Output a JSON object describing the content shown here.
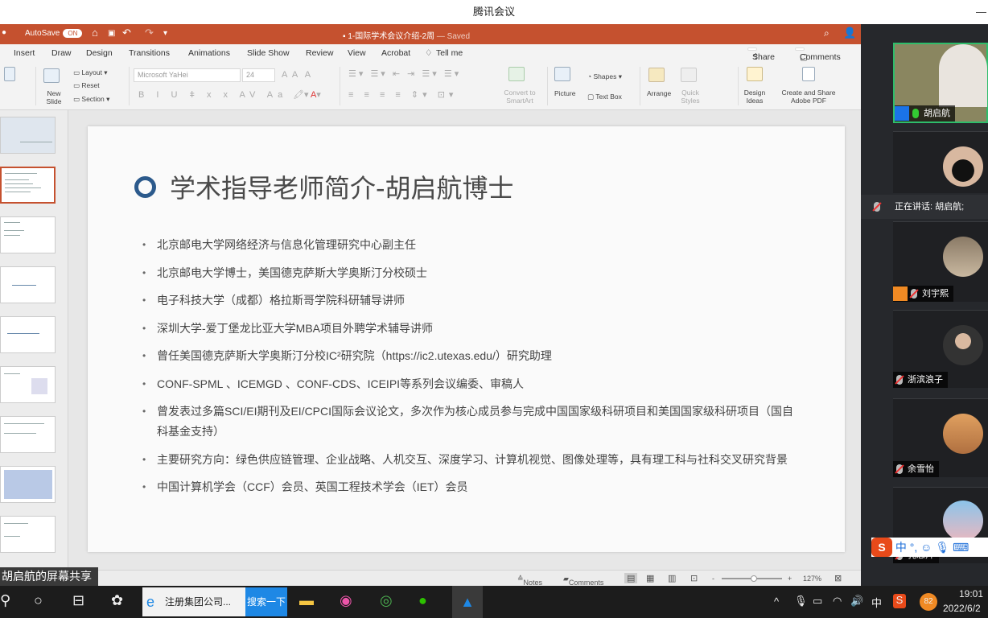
{
  "meeting": {
    "app_title": "腾讯会议",
    "share_label": "胡启航的屏幕共享",
    "speaking_label": "正在讲话: 胡启航;"
  },
  "ppt": {
    "autosave_label": "AutoSave",
    "autosave_state": "ON",
    "doc_title": "1-国际学术会议介绍-2周",
    "saved_status": "— Saved",
    "accent_color": "#c5512f",
    "tabs": [
      "Insert",
      "Draw",
      "Design",
      "Transitions",
      "Animations",
      "Slide Show",
      "Review",
      "View",
      "Acrobat",
      "Tell me"
    ],
    "share_label": "Share",
    "comments_label": "Comments",
    "ribbon": {
      "new_slide": "New Slide",
      "layout": "Layout",
      "reset": "Reset",
      "section": "Section",
      "font_name": "Microsoft YaHei",
      "font_size": "24",
      "convert_smartart": "Convert to SmartArt",
      "picture": "Picture",
      "shapes": "Shapes",
      "text_box": "Text Box",
      "arrange": "Arrange",
      "quick_styles": "Quick Styles",
      "design_ideas": "Design Ideas",
      "create_share_pdf": "Create and Share Adobe PDF"
    },
    "slide": {
      "title": "学术指导老师简介-胡启航博士",
      "bullets": [
        "北京邮电大学网络经济与信息化管理研究中心副主任",
        "北京邮电大学博士，美国德克萨斯大学奥斯汀分校硕士",
        "电子科技大学（成都）格拉斯哥学院科研辅导讲师",
        "深圳大学-爱丁堡龙比亚大学MBA项目外聘学术辅导讲师",
        "曾任美国德克萨斯大学奥斯汀分校IC²研究院（https://ic2.utexas.edu/）研究助理",
        "CONF-SPML 、ICEMGD 、CONF-CDS、ICEIPI等系列会议编委、审稿人",
        "曾发表过多篇SCI/EI期刊及EI/CPCI国际会议论文，多次作为核心成员参与完成中国国家级科研项目和美国国家级科研项目（国自科基金支持）",
        "主要研究方向：绿色供应链管理、企业战略、人机交互、深度学习、计算机视觉、图像处理等，具有理工科与社科交叉研究背景",
        "中国计算机学会（CCF）会员、英国工程技术学会（IET）会员"
      ]
    },
    "status": {
      "notes": "Notes",
      "comments": "Comments",
      "zoom": "127%",
      "zoom_minus": "-",
      "zoom_plus": "+"
    }
  },
  "participants": [
    {
      "name": "胡启航",
      "mic": "on"
    },
    {
      "name": "",
      "mic": "off"
    },
    {
      "name": "刘宇熙",
      "mic": "off"
    },
    {
      "name": "浙滨浪子",
      "mic": "off"
    },
    {
      "name": "余雪怡",
      "mic": "off"
    },
    {
      "name": "孔志拜",
      "mic": "off"
    }
  ],
  "taskbar": {
    "search_text": "注册集团公司...",
    "search_button": "搜索一下",
    "ime_lang": "中",
    "battery_badge": "82",
    "time": "19:01",
    "date": "2022/6/2"
  },
  "ime": {
    "lang": "中",
    "punct": "°,"
  }
}
